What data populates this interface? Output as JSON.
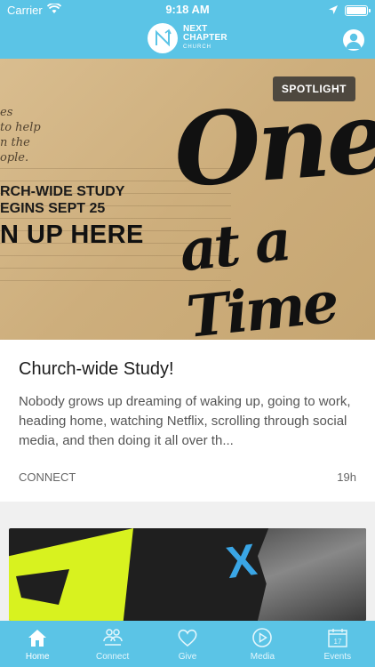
{
  "status_bar": {
    "carrier": "Carrier",
    "time": "9:18 AM"
  },
  "header": {
    "logo_line1": "NEXT",
    "logo_line2": "CHAPTER",
    "logo_line3": "CHURCH"
  },
  "featured_card": {
    "badge": "SPOTLIGHT",
    "image_text": {
      "script": "es\nto help\nn the\nople.",
      "study_line1": "RCH-WIDE STUDY",
      "study_line2": "EGINS SEPT 25",
      "signup": "N UP HERE",
      "big1": "One",
      "big2": "at a Time"
    },
    "title": "Church-wide Study!",
    "description": "Nobody grows up dreaming of waking up, going to work, heading home, watching Netflix, scrolling through social media, and then doing it all over th...",
    "category": "CONNECT",
    "age": "19h"
  },
  "second_card": {
    "graphic_text": "X"
  },
  "tabbar": {
    "tabs": [
      {
        "label": "Home",
        "icon": "home-icon",
        "active": true
      },
      {
        "label": "Connect",
        "icon": "people-icon",
        "active": false
      },
      {
        "label": "Give",
        "icon": "heart-icon",
        "active": false
      },
      {
        "label": "Media",
        "icon": "play-icon",
        "active": false
      },
      {
        "label": "Events",
        "icon": "calendar-icon",
        "active": false,
        "badge": "17"
      }
    ]
  },
  "colors": {
    "brand": "#5bc4e6",
    "tab_inactive": "#e3f6fc"
  }
}
